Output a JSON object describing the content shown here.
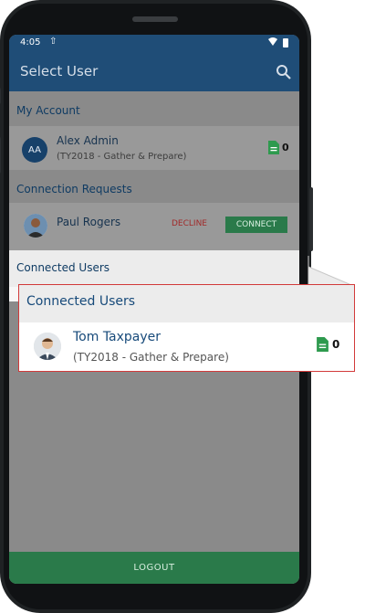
{
  "status_bar": {
    "time": "4:05"
  },
  "app_bar": {
    "title": "Select User"
  },
  "my_account": {
    "header": "My Account",
    "user": {
      "initials": "AA",
      "name": "Alex Admin",
      "subtitle": "(TY2018 - Gather & Prepare)",
      "doc_count": "0"
    }
  },
  "connection_requests": {
    "header": "Connection Requests",
    "user": {
      "name": "Paul Rogers",
      "decline_label": "DECLINE",
      "connect_label": "CONNECT"
    }
  },
  "connected_users": {
    "header": "Connected Users",
    "user": {
      "name": "Tom Taxpayer",
      "subtitle": "(TY2018 - Gather & Prepare)",
      "doc_count": "0"
    }
  },
  "footer": {
    "logout_label": "LOGOUT"
  },
  "colors": {
    "brand_blue": "#1f4d77",
    "accent_green": "#2a7a4a",
    "decline_red": "#a12a2a",
    "callout_border": "#d23a3a"
  },
  "icons": [
    "upload-icon",
    "wifi-icon",
    "battery-icon",
    "search-icon",
    "document-icon"
  ]
}
